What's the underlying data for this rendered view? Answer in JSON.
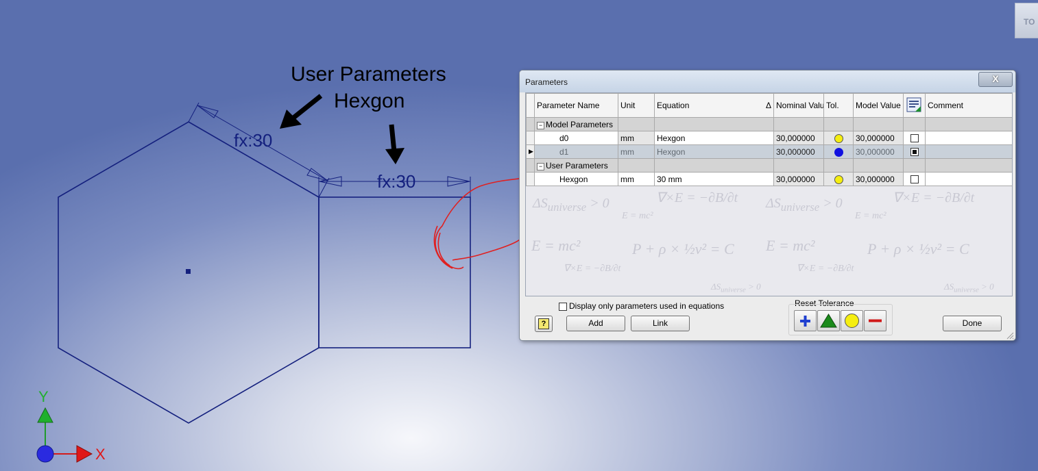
{
  "viewcube": {
    "label": "TO"
  },
  "annotations": {
    "callout_line1": "User Parameters",
    "callout_line2": "Hexgon"
  },
  "sketch": {
    "dim_hex_side": "fx:30",
    "dim_square_top": "fx:30"
  },
  "axes": {
    "y_label": "Y",
    "x_label": "X"
  },
  "dialog": {
    "title": "Parameters",
    "close_label": "X",
    "columns": [
      "Parameter Name",
      "Unit",
      "Equation",
      "Nominal Valu",
      "Tol.",
      "Model Value",
      "",
      "Comment"
    ],
    "sort_indicator": "Δ",
    "groups": [
      {
        "name": "Model Parameters",
        "rows": [
          {
            "name": "d0",
            "unit": "mm",
            "equation": "Hexgon",
            "nominal": "30,000000",
            "tol": "yellow",
            "model": "30,000000",
            "export": false,
            "comment": ""
          },
          {
            "name": "d1",
            "unit": "mm",
            "equation": "Hexgon",
            "nominal": "30,000000",
            "tol": "blue",
            "model": "30,000000",
            "export": true,
            "comment": ""
          }
        ]
      },
      {
        "name": "User Parameters",
        "rows": [
          {
            "name": "Hexgon",
            "unit": "mm",
            "equation": "30 mm",
            "nominal": "30,000000",
            "tol": "yellow",
            "model": "30,000000",
            "export": false,
            "comment": ""
          }
        ]
      }
    ],
    "filter_checkbox_label": "Display only parameters used in equations",
    "help_label": "?",
    "add_label": "Add",
    "link_label": "Link",
    "reset_tolerance_label": "Reset Tolerance",
    "done_label": "Done"
  },
  "colors": {
    "sketch_line": "#14207e",
    "annotation_red": "#e02020",
    "tol_yellow": "#f5ee10",
    "tol_blue": "#1010e0",
    "tol_green": "#1a8a1a"
  }
}
